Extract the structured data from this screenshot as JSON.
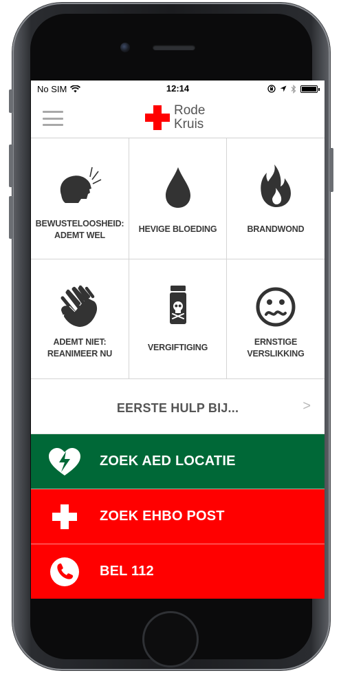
{
  "status": {
    "carrier": "No SIM",
    "time": "12:14"
  },
  "nav": {
    "logo_line1": "Rode",
    "logo_line2": "Kruis"
  },
  "tiles": [
    {
      "label_line1": "BEWUSTELOOSHEID:",
      "label_line2": "ADEMT WEL",
      "icon": "unconscious-breathing-icon"
    },
    {
      "label_line1": "HEVIGE BLOEDING",
      "label_line2": "",
      "icon": "blood-drop-icon"
    },
    {
      "label_line1": "BRANDWOND",
      "label_line2": "",
      "icon": "flame-icon"
    },
    {
      "label_line1": "ADEMT NIET:",
      "label_line2": "REANIMEER NU",
      "icon": "cpr-hands-icon"
    },
    {
      "label_line1": "VERGIFTIGING",
      "label_line2": "",
      "icon": "poison-bottle-icon"
    },
    {
      "label_line1": "ERNSTIGE",
      "label_line2": "VERSLIKKING",
      "icon": "choking-face-icon"
    }
  ],
  "first_aid": {
    "label": "EERSTE HULP BIJ...",
    "chevron": ">"
  },
  "actions": [
    {
      "label": "ZOEK AED LOCATIE",
      "icon": "aed-heart-icon",
      "color": "#006837"
    },
    {
      "label": "ZOEK EHBO POST",
      "icon": "cross-icon",
      "color": "#ff0000"
    },
    {
      "label": "BEL 112",
      "icon": "phone-icon",
      "color": "#ff0000"
    }
  ],
  "colors": {
    "brand_red": "#ff0000",
    "aed_green": "#006837",
    "icon_dark": "#333333"
  }
}
